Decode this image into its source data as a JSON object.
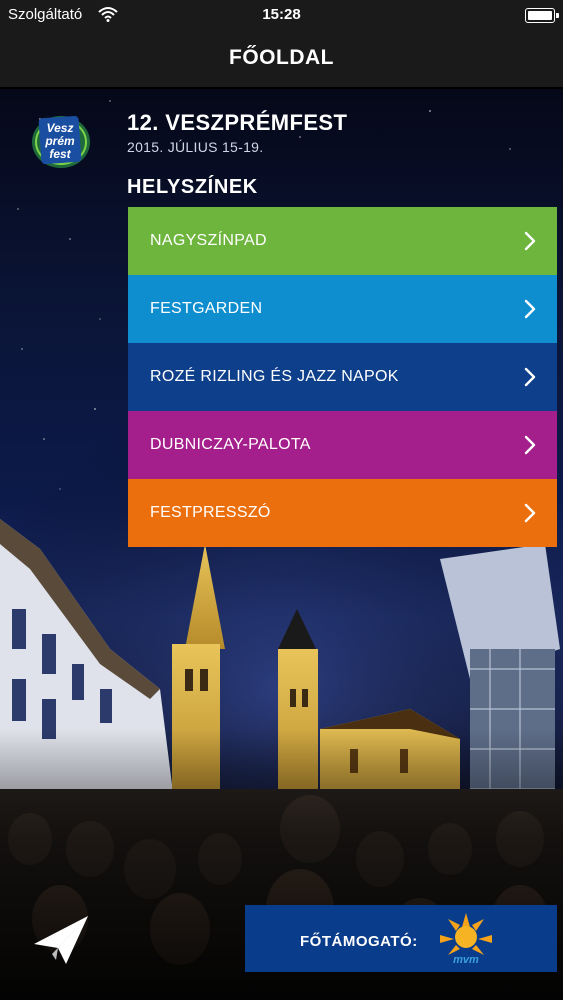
{
  "status_bar": {
    "carrier": "Szolgáltató",
    "time": "15:28"
  },
  "nav": {
    "title": "FŐOLDAL"
  },
  "festival": {
    "title": "12. VESZPRÉMFEST",
    "date": "2015. JÚLIUS 15-19.",
    "logo_text": [
      "Vesz",
      "prém",
      "fest"
    ]
  },
  "venues": {
    "title": "HELYSZÍNEK",
    "items": [
      {
        "label": "NAGYSZÍNPAD",
        "color": "#6eb53d"
      },
      {
        "label": "FESTGARDEN",
        "color": "#0f8ecf"
      },
      {
        "label": "ROZÉ RIZLING ÉS JAZZ NAPOK",
        "color": "#0e3f8a"
      },
      {
        "label": "DUBNICZAY-PALOTA",
        "color": "#a51f8c"
      },
      {
        "label": "FESTPRESSZÓ",
        "color": "#ec6f0e"
      }
    ]
  },
  "sponsor": {
    "label": "FŐTÁMOGATÓ:",
    "logo_text": "mvm"
  },
  "icons": {
    "wifi": "wifi-icon",
    "battery": "battery-icon",
    "chevron": "chevron-right-icon",
    "share": "paper-plane-icon"
  }
}
